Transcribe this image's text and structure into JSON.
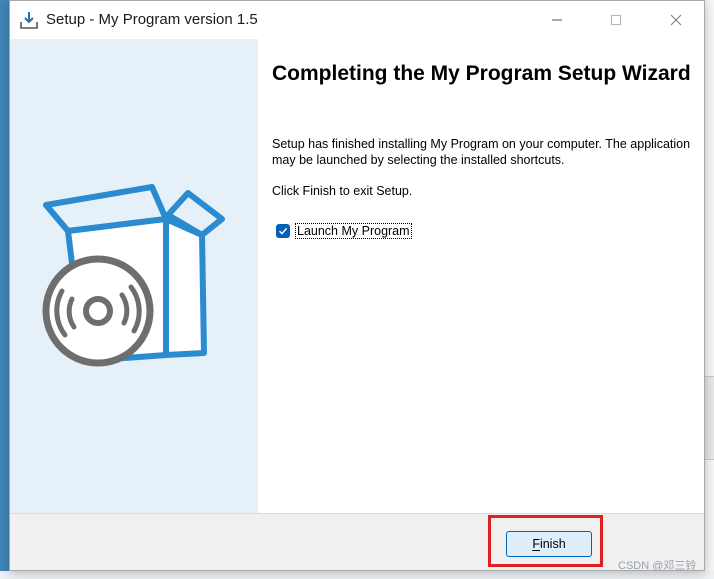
{
  "window": {
    "title": "Setup - My Program version 1.5",
    "icon": "installer-download-icon"
  },
  "titlebar_buttons": {
    "minimize": "minimize-icon",
    "maximize": "maximize-icon",
    "close": "close-icon"
  },
  "sidebar": {
    "illustration": "software-box-with-disc-icon"
  },
  "content": {
    "heading": "Completing the My Program Setup Wizard",
    "description": "Setup has finished installing My Program on your computer. The application may be launched by selecting the installed shortcuts.",
    "exit_hint": "Click Finish to exit Setup.",
    "launch_checkbox": {
      "label": "Launch My Program",
      "checked": true
    }
  },
  "footer": {
    "finish_label": "Finish"
  },
  "watermark": "CSDN @邓三铃",
  "colors": {
    "accent": "#005fb8",
    "sidebar_bg": "#e5f0f8",
    "box_blue": "#2a8bd0",
    "disc_gray": "#6e6e6e",
    "highlight_red": "#e02020"
  }
}
